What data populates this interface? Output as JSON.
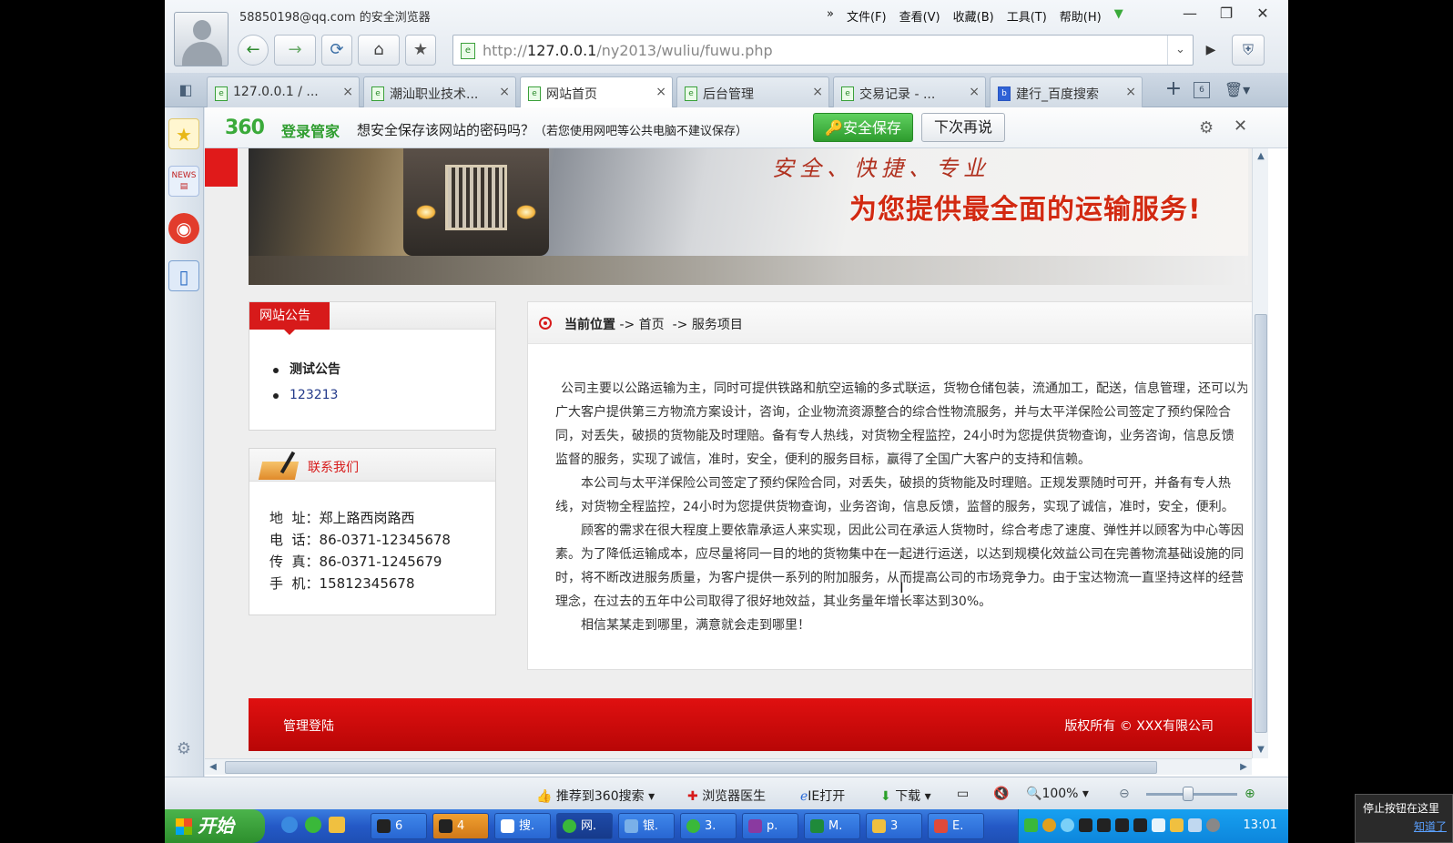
{
  "window": {
    "title": "58850198@qq.com 的安全浏览器",
    "menu": [
      "文件(F)",
      "查看(V)",
      "收藏(B)",
      "工具(T)",
      "帮助(H)"
    ],
    "menu_more": "»",
    "controls": {
      "minimize": "—",
      "restore": "❐",
      "close": "✕"
    }
  },
  "nav": {
    "back": "←",
    "forward": "→",
    "refresh": "⟳",
    "home": "⌂",
    "favorite": "★",
    "url_prefix": "http://",
    "url_host": "127.0.0.1",
    "url_path": "/ny2013/wuliu/fuwu.php",
    "go": "▶",
    "dropdown": "⌄",
    "shield": "⛨"
  },
  "tabs": [
    {
      "label": "127.0.0.1 / ...",
      "active": false,
      "icon": "page-icon"
    },
    {
      "label": "潮汕职业技术...",
      "active": false,
      "icon": "page-icon"
    },
    {
      "label": "网站首页",
      "active": true,
      "icon": "page-icon"
    },
    {
      "label": "后台管理",
      "active": false,
      "icon": "page-icon"
    },
    {
      "label": "交易记录 - ...",
      "active": false,
      "icon": "page-icon"
    },
    {
      "label": "建行_百度搜索",
      "active": false,
      "icon": "baidu-icon"
    }
  ],
  "tab_close": "×",
  "tab_new": "+",
  "tab_count": "6",
  "notification": {
    "brand": "360",
    "label": "登录管家",
    "message": "想安全保存该网站的密码吗？",
    "hint": "（若您使用网吧等公共电脑不建议保存）",
    "save": "安全保存",
    "later": "下次再说"
  },
  "banner": {
    "slogan_top": "安全、快捷、专业",
    "slogan_main": "为您提供最全面的运输服务!"
  },
  "notice": {
    "title": "网站公告",
    "items": [
      "测试公告",
      "123213"
    ]
  },
  "contact": {
    "title": "联系我们",
    "lines": [
      "地  址：郑上路西岗路西",
      "电  话：86-0371-12345678",
      "传  真：86-0371-1245679",
      "手  机：15812345678"
    ]
  },
  "breadcrumb": {
    "label": "当前位置",
    "path": " -> 首页  -> 服务项目"
  },
  "article": [
    "公司主要以公路运输为主，同时可提供铁路和航空运输的多式联运，货物仓储包装，流通加工，配送，信息管理，还可以为",
    "广大客户提供第三方物流方案设计，咨询，企业物流资源整合的综合性物流服务，并与太平洋保险公司签定了预约保险合",
    "同，对丢失，破损的货物能及时理赔。备有专人热线，对货物全程监控，24小时为您提供货物查询，业务咨询，信息反馈",
    "监督的服务，实现了诚信，准时，安全，便利的服务目标，赢得了全国广大客户的支持和信赖。",
    "本公司与太平洋保险公司签定了预约保险合同，对丢失，破损的货物能及时理赔。正规发票随时可开，并备有专人热",
    "线，对货物全程监控，24小时为您提供货物查询，业务咨询，信息反馈，监督的服务，实现了诚信，准时，安全，便利。",
    "顾客的需求在很大程度上要依靠承运人来实现，因此公司在承运人货物时，综合考虑了速度、弹性并以顾客为中心等因",
    "素。为了降低运输成本，应尽量将同一目的地的货物集中在一起进行运送，以达到规模化效益公司在完善物流基础设施的同",
    "时，将不断改进服务质量，为客户提供一系列的附加服务，从而提高公司的市场竞争力。由于宝达物流一直坚持这样的经营",
    "理念，在过去的五年中公司取得了很好地效益，其业务量年增长率达到30%。",
    "相信某某走到哪里，满意就会走到哪里！"
  ],
  "footer": {
    "admin_login": "管理登陆",
    "copyright": "版权所有 © XXX有限公司"
  },
  "statusbar": {
    "recommend": "推荐到360搜索",
    "doctor": "浏览器医生",
    "ie_open": "IE打开",
    "download": "下载",
    "zoom": "100%"
  },
  "taskbar": {
    "start": "开始",
    "items": [
      "6",
      "4",
      "搜.",
      "网.",
      "银.",
      "3.",
      "p.",
      "M.",
      "3",
      "E."
    ],
    "clock": "13:01"
  },
  "overlay": {
    "text": "停止按钮在这里",
    "link": "知道了"
  },
  "colors": {
    "accent_red": "#d71a1a",
    "brand_green": "#2e9c2e",
    "taskbar_blue": "#2459c6"
  }
}
